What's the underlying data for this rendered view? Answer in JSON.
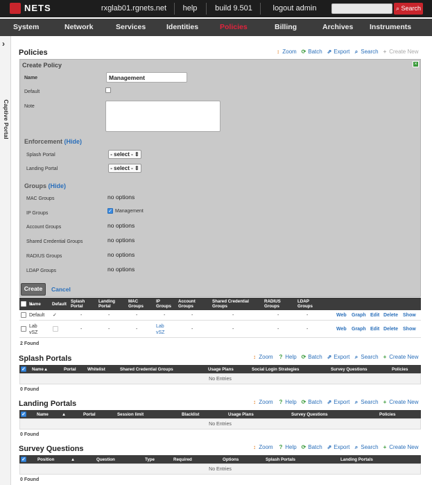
{
  "topbar": {
    "logo": "NETS",
    "host": "rxglab01.rgnets.net",
    "help": "help",
    "build": "build 9.501",
    "logout": "logout admin",
    "search_placeholder": "",
    "search_button": "Search"
  },
  "nav": [
    "System",
    "Network",
    "Services",
    "Identities",
    "Policies",
    "Billing",
    "Archives",
    "Instruments"
  ],
  "sidebar": {
    "label": "Captive Portal"
  },
  "policies": {
    "title": "Policies",
    "actions": {
      "zoom": "Zoom",
      "batch": "Batch",
      "export": "Export",
      "search": "Search",
      "create_new": "Create New"
    },
    "create": {
      "title": "Create Policy",
      "name_label": "Name",
      "name_value": "Management",
      "default_label": "Default",
      "note_label": "Note",
      "enforcement_title": "Enforcement",
      "hide": "(Hide)",
      "splash_label": "Splash Portal",
      "landing_label": "Landing Portal",
      "select_text": "- select -",
      "groups_title": "Groups",
      "mac_label": "MAC Groups",
      "ip_label": "IP Groups",
      "account_label": "Account Groups",
      "shared_label": "Shared Credential Groups",
      "radius_label": "RADIUS Groups",
      "ldap_label": "LDAP Groups",
      "no_options": "no options",
      "ip_option": "Management",
      "create_button": "Create",
      "cancel_link": "Cancel"
    },
    "table": {
      "headers": [
        "Name",
        "Default",
        "Splash Portal",
        "Landing Portal",
        "MAC Groups",
        "IP Groups",
        "Account Groups",
        "Shared Credential Groups",
        "RADIUS Groups",
        "LDAP Groups"
      ],
      "rows": [
        {
          "name": "Default",
          "default": "✓",
          "splash": "-",
          "landing": "-",
          "mac": "-",
          "ip": "-",
          "account": "-",
          "shared": "-",
          "radius": "-",
          "ldap": "-"
        },
        {
          "name": "Lab vSZ",
          "default": "",
          "splash": "-",
          "landing": "-",
          "mac": "-",
          "ip": "Lab vSZ",
          "account": "-",
          "shared": "-",
          "radius": "-",
          "ldap": "-"
        }
      ],
      "row_actions": [
        "Web",
        "Graph",
        "Edit",
        "Delete",
        "Show"
      ]
    },
    "found": "2 Found"
  },
  "splash": {
    "title": "Splash Portals",
    "actions": {
      "zoom": "Zoom",
      "help": "Help",
      "batch": "Batch",
      "export": "Export",
      "search": "Search",
      "create_new": "Create New"
    },
    "headers": [
      "Name",
      "Portal",
      "Whitelist",
      "Shared Credential Groups",
      "Usage Plans",
      "Social Login Strategies",
      "Survey Questions",
      "Policies"
    ],
    "empty": "No Entries",
    "found": "0 Found"
  },
  "landing": {
    "title": "Landing Portals",
    "actions": {
      "zoom": "Zoom",
      "help": "Help",
      "batch": "Batch",
      "export": "Export",
      "search": "Search",
      "create_new": "Create New"
    },
    "headers": [
      "Name",
      "Portal",
      "Session limit",
      "Blacklist",
      "Usage Plans",
      "Survey Questions",
      "Policies"
    ],
    "empty": "No Entries",
    "found": "0 Found"
  },
  "survey": {
    "title": "Survey Questions",
    "actions": {
      "zoom": "Zoom",
      "help": "Help",
      "batch": "Batch",
      "export": "Export",
      "search": "Search",
      "create_new": "Create New"
    },
    "headers": [
      "Position",
      "Question",
      "Type",
      "Required",
      "Options",
      "Splash Portals",
      "Landing Portals"
    ],
    "empty": "No Entries",
    "found": "0 Found"
  }
}
